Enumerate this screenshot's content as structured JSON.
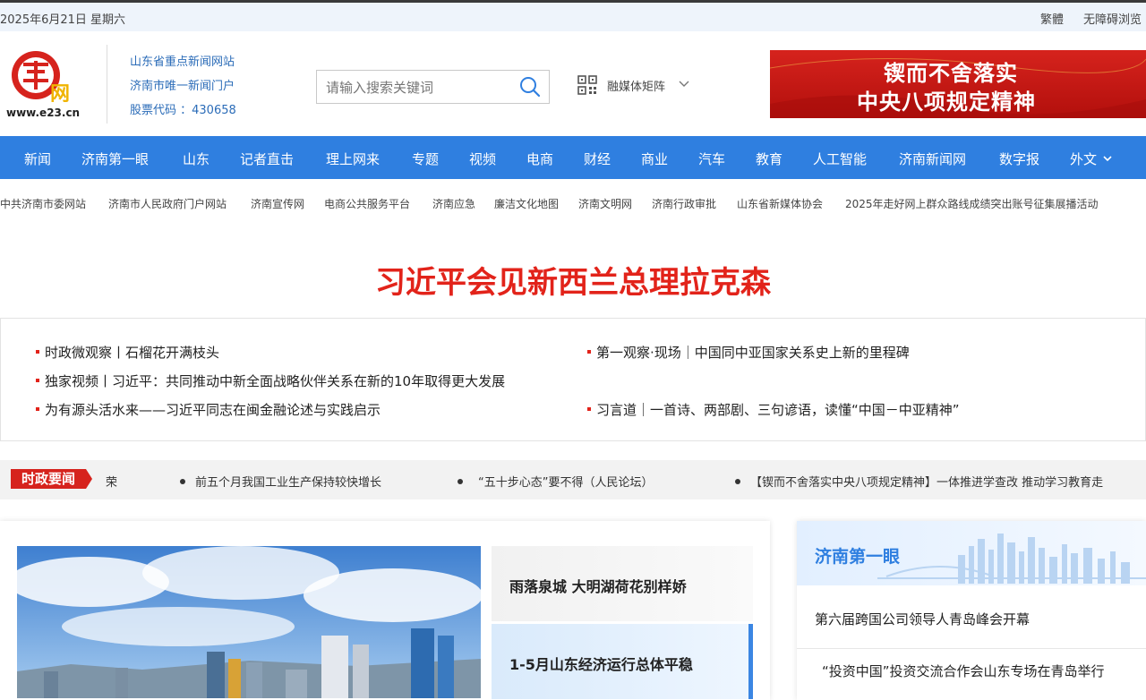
{
  "topbar": {
    "date": "2025年6月21日 星期六",
    "traditional": "繁體",
    "accessible": "无障碍浏览"
  },
  "header": {
    "tagline1": "山东省重点新闻网站",
    "tagline2": "济南市唯一新闻门户",
    "tagline3": "股票代码 ：430658",
    "search_placeholder": "请输入搜索关键词",
    "matrix_label": "融媒体矩阵",
    "banner_line1": "锲而不舍落实",
    "banner_line2": "中央八项规定精神",
    "logo_url": "www.e23.cn"
  },
  "nav": [
    "新闻",
    "济南第一眼",
    "山东",
    "记者直击",
    "理上网来",
    "专题",
    "视频",
    "电商",
    "财经",
    "商业",
    "汽车",
    "教育",
    "人工智能",
    "济南新闻网",
    "数字报",
    "外文"
  ],
  "links": [
    "中共济南市委网站",
    "济南市人民政府门户网站",
    "济南宣传网",
    "电商公共服务平台",
    "济南应急",
    "廉洁文化地图",
    "济南文明网",
    "济南行政审批",
    "山东省新媒体协会",
    "2025年走好网上群众路线成绩突出账号征集展播活动"
  ],
  "headline": "习近平会见新西兰总理拉克森",
  "news": [
    "时政微观察丨石榴花开满枝头",
    "第一观察·现场｜中国同中亚国家关系史上新的里程碑",
    "独家视频丨习近平：共同推动中新全面战略伙伴关系在新的10年取得更大发展",
    "为有源头活水来——习近平同志在闽金融论述与实践启示",
    "习言道｜一首诗、两部剧、三句谚语，读懂“中国－中亚精神”"
  ],
  "ticker": {
    "tag": "时政要闻",
    "items": [
      "荣",
      "前五个月我国工业生产保持较快增长",
      "“五十步心态”要不得（人民论坛）",
      "【锲而不舍落实中央八项规定精神】一体推进学查改 推动学习教育走"
    ]
  },
  "feature": {
    "side1": "雨落泉城 大明湖荷花别样娇",
    "side2": "1-5月山东经济运行总体平稳"
  },
  "right_panel": {
    "title": "济南第一眼",
    "items": [
      "第六届跨国公司领导人青岛峰会开幕",
      "“投资中国”投资交流合作会山东专场在青岛举行"
    ]
  },
  "colors": {
    "nav_bg": "#2f7fe0",
    "headline_red": "#e2231a",
    "banner_red": "#d6231d"
  }
}
